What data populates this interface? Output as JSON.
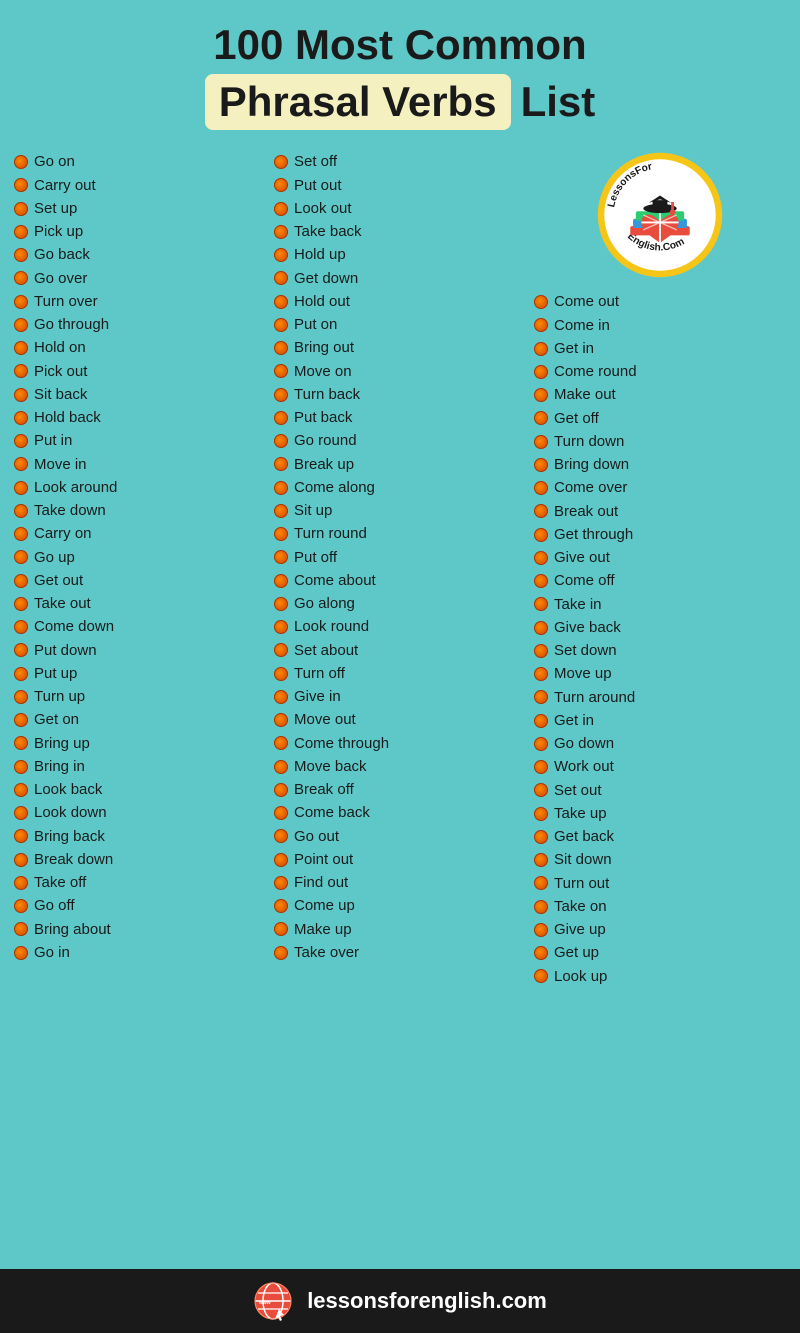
{
  "header": {
    "line1": "100 Most Common",
    "line2_highlight": "Phrasal Verbs",
    "line2_rest": "List"
  },
  "column1": {
    "items": [
      "Go on",
      "Carry out",
      "Set up",
      "Pick up",
      "Go back",
      "Go over",
      "Turn over",
      "Go through",
      "Hold on",
      "Pick out",
      "Sit back",
      "Hold back",
      "Put in",
      "Move in",
      "Look around",
      "Take down",
      "Carry on",
      "Go up",
      "Get out",
      "Take out",
      "Come down",
      "Put down",
      "Put up",
      "Turn up",
      "Get on",
      "Bring up",
      "Bring in",
      "Look back",
      "Look down",
      "Bring back",
      "Break down",
      "Take off",
      "Go off",
      "Bring about",
      "Go in"
    ]
  },
  "column2": {
    "items": [
      "Set off",
      "Put out",
      "Look out",
      "Take back",
      "Hold up",
      "Get down",
      "Hold out",
      "Put on",
      "Bring out",
      "Move on",
      "Turn back",
      "Put back",
      "Go round",
      "Break up",
      "Come along",
      "Sit up",
      "Turn round",
      "Put off",
      "Come about",
      "Go along",
      "Look round",
      "Set about",
      "Turn off",
      "Give in",
      "Move out",
      "Come through",
      "Move back",
      "Break off",
      "Come back",
      "Go out",
      "Point out",
      "Find out",
      "Come up",
      "Make up",
      "Take over"
    ]
  },
  "column3": {
    "items": [
      "Come out",
      "Come in",
      "Get in",
      "Come round",
      "Make out",
      "Get off",
      "Turn down",
      "Bring down",
      "Come over",
      "Break out",
      "Get through",
      "Give out",
      "Come off",
      "Take in",
      "Give back",
      "Set down",
      "Move up",
      "Turn around",
      "Get in",
      "Go down",
      "Work out",
      "Set out",
      "Take up",
      "Get back",
      "Sit down",
      "Turn out",
      "Take on",
      "Give up",
      "Get up",
      "Look up"
    ]
  },
  "footer": {
    "url": "lessonsforenglish.com"
  }
}
